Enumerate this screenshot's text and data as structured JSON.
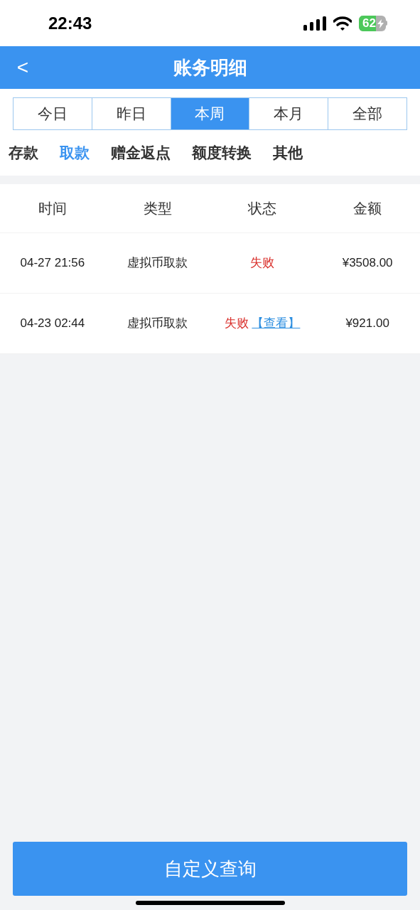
{
  "status_bar": {
    "time": "22:43",
    "battery": "62"
  },
  "header": {
    "title": "账务明细",
    "back": "<"
  },
  "period_tabs": [
    {
      "label": "今日",
      "selected": false
    },
    {
      "label": "昨日",
      "selected": false
    },
    {
      "label": "本周",
      "selected": true
    },
    {
      "label": "本月",
      "selected": false
    },
    {
      "label": "全部",
      "selected": false
    }
  ],
  "type_tabs": [
    {
      "label": "存款",
      "selected": false
    },
    {
      "label": "取款",
      "selected": true
    },
    {
      "label": "赠金返点",
      "selected": false
    },
    {
      "label": "额度转换",
      "selected": false
    },
    {
      "label": "其他",
      "selected": false
    }
  ],
  "table": {
    "columns": [
      "时间",
      "类型",
      "状态",
      "金额"
    ],
    "rows": [
      {
        "time": "04-27 21:56",
        "type": "虚拟币取款",
        "status": "失败",
        "link": null,
        "amount": "¥3508.00"
      },
      {
        "time": "04-23 02:44",
        "type": "虚拟币取款",
        "status": "失败",
        "link": "【查看】",
        "amount": "¥921.00"
      }
    ]
  },
  "query_button": "自定义查询"
}
